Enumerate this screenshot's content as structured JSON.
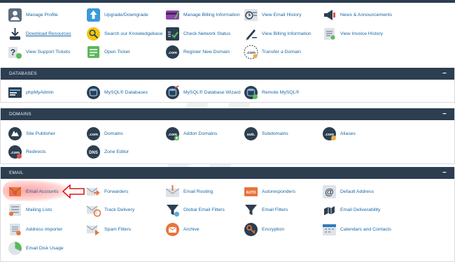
{
  "top_items": [
    {
      "label": "Manage Profile",
      "icon": "profile-icon",
      "underline": false
    },
    {
      "label": "Upgrade/Downgrade",
      "icon": "upgrade-icon",
      "underline": false
    },
    {
      "label": "Manage Billing Information",
      "icon": "billing-icon",
      "underline": false
    },
    {
      "label": "View Email History",
      "icon": "email-history-icon",
      "underline": false
    },
    {
      "label": "News & Announcements",
      "icon": "news-icon",
      "underline": false
    },
    {
      "label": "Download Resources",
      "icon": "download-icon",
      "underline": true
    },
    {
      "label": "Search our Knowledgebase",
      "icon": "knowledgebase-icon",
      "underline": false
    },
    {
      "label": "Check Network Status",
      "icon": "network-status-icon",
      "underline": false
    },
    {
      "label": "View Billing Information",
      "icon": "view-billing-icon",
      "underline": false
    },
    {
      "label": "View Invoice History",
      "icon": "invoice-icon",
      "underline": false
    },
    {
      "label": "View Support Tickets",
      "icon": "support-tickets-icon",
      "underline": false
    },
    {
      "label": "Open Ticket",
      "icon": "open-ticket-icon",
      "underline": false
    },
    {
      "label": "Register New Domain",
      "icon": "register-domain-icon",
      "underline": false
    },
    {
      "label": "Transfer a Domain",
      "icon": "transfer-domain-icon",
      "underline": false
    }
  ],
  "databases": {
    "title": "DATABASES",
    "collapse": "−",
    "items": [
      {
        "label": "phpMyAdmin",
        "icon": "phpmyadmin-icon"
      },
      {
        "label": "MySQL® Databases",
        "icon": "mysql-icon"
      },
      {
        "label": "MySQL® Database Wizard",
        "icon": "mysql-wizard-icon"
      },
      {
        "label": "Remote MySQL®",
        "icon": "remote-mysql-icon"
      }
    ]
  },
  "domains": {
    "title": "DOMAINS",
    "collapse": "−",
    "items": [
      {
        "label": "Site Publisher",
        "icon": "site-publisher-icon"
      },
      {
        "label": "Domains",
        "icon": "domains-icon",
        "badge": ".com"
      },
      {
        "label": "Addon Domains",
        "icon": "addon-domains-icon",
        "badge": ".com"
      },
      {
        "label": "Subdomains",
        "icon": "subdomains-icon",
        "badge": "sub."
      },
      {
        "label": "Aliases",
        "icon": "aliases-icon",
        "badge": ".com"
      },
      {
        "label": "Redirects",
        "icon": "redirects-icon",
        "badge": ".com"
      },
      {
        "label": "Zone Editor",
        "icon": "dns-icon",
        "badge": "DNS"
      }
    ]
  },
  "email": {
    "title": "EMAIL",
    "collapse": "−",
    "items": [
      {
        "label": "Email Accounts",
        "icon": "email-accounts-icon"
      },
      {
        "label": "Forwarders",
        "icon": "forwarders-icon"
      },
      {
        "label": "Email Routing",
        "icon": "email-routing-icon"
      },
      {
        "label": "Autoresponders",
        "icon": "autoresponders-icon",
        "badge": "AUTO"
      },
      {
        "label": "Default Address",
        "icon": "default-address-icon"
      },
      {
        "label": "Mailing Lists",
        "icon": "mailing-lists-icon"
      },
      {
        "label": "Track Delivery",
        "icon": "track-delivery-icon"
      },
      {
        "label": "Global Email Filters",
        "icon": "global-filters-icon"
      },
      {
        "label": "Email Filters",
        "icon": "email-filters-icon"
      },
      {
        "label": "Email Deliverability",
        "icon": "deliverability-icon"
      },
      {
        "label": "Address Importer",
        "icon": "address-importer-icon"
      },
      {
        "label": "Spam Filters",
        "icon": "spam-filters-icon"
      },
      {
        "label": "Archive",
        "icon": "archive-icon"
      },
      {
        "label": "Encryption",
        "icon": "encryption-icon"
      },
      {
        "label": "Calendars and Contacts",
        "icon": "calendars-icon"
      },
      {
        "label": "Email Disk Usage",
        "icon": "disk-usage-icon"
      }
    ]
  },
  "highlight_target": "Email Accounts",
  "watermark_text": "Monovm",
  "colors": {
    "header": "#2c3e50",
    "link": "#1a67a3",
    "highlight": "#ff6464",
    "arrow": "#e01515"
  }
}
